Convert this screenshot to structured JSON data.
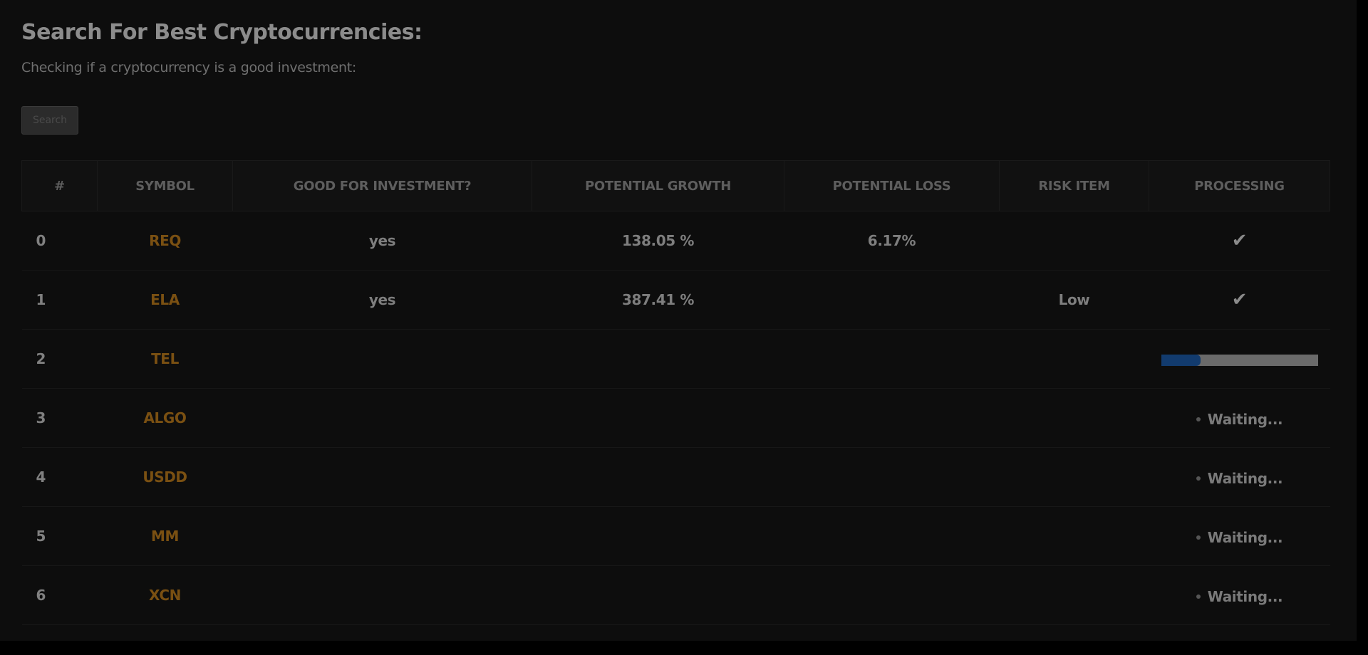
{
  "header": {
    "title": "Search For Best Cryptocurrencies:",
    "subtitle": "Checking if a cryptocurrency is a good investment:"
  },
  "search": {
    "button_label": "Search"
  },
  "table": {
    "columns": [
      "#",
      "SYMBOL",
      "GOOD FOR INVESTMENT?",
      "POTENTIAL GROWTH",
      "POTENTIAL LOSS",
      "RISK ITEM",
      "PROCESSING"
    ],
    "rows": [
      {
        "index": "0",
        "symbol": "REQ",
        "good": "yes",
        "growth": "138.05 %",
        "loss": "6.17%",
        "risk": "",
        "status": "done"
      },
      {
        "index": "1",
        "symbol": "ELA",
        "good": "yes",
        "growth": "387.41 %",
        "loss": "",
        "risk": "Low",
        "status": "done"
      },
      {
        "index": "2",
        "symbol": "TEL",
        "good": "",
        "growth": "",
        "loss": "",
        "risk": "",
        "status": "processing",
        "progress_percent": 25
      },
      {
        "index": "3",
        "symbol": "ALGO",
        "good": "",
        "growth": "",
        "loss": "",
        "risk": "",
        "status": "waiting",
        "status_label": "Waiting..."
      },
      {
        "index": "4",
        "symbol": "USDD",
        "good": "",
        "growth": "",
        "loss": "",
        "risk": "",
        "status": "waiting",
        "status_label": "Waiting..."
      },
      {
        "index": "5",
        "symbol": "MM",
        "good": "",
        "growth": "",
        "loss": "",
        "risk": "",
        "status": "waiting",
        "status_label": "Waiting..."
      },
      {
        "index": "6",
        "symbol": "XCN",
        "good": "",
        "growth": "",
        "loss": "",
        "risk": "",
        "status": "waiting",
        "status_label": "Waiting..."
      }
    ]
  },
  "icons": {
    "done": "check-icon",
    "waiting": "dot-icon"
  },
  "colors": {
    "symbol": "#7a5012",
    "progress_fill": "#123b6e",
    "progress_track": "#6a6a6a"
  }
}
